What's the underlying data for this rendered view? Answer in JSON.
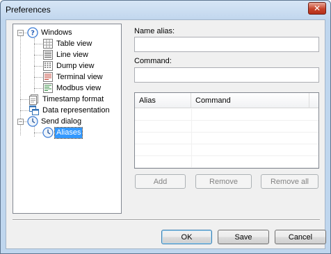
{
  "window": {
    "title": "Preferences",
    "close_glyph": "✕"
  },
  "tree": {
    "items": [
      {
        "label": "Windows",
        "icon": "help-icon",
        "level": 0,
        "expander": "−"
      },
      {
        "label": "Table view",
        "icon": "table-icon",
        "level": 1
      },
      {
        "label": "Line view",
        "icon": "lines-icon",
        "level": 1
      },
      {
        "label": "Dump view",
        "icon": "dump-icon",
        "level": 1
      },
      {
        "label": "Terminal view",
        "icon": "terminal-icon",
        "level": 1
      },
      {
        "label": "Modbus view",
        "icon": "modbus-icon",
        "level": 1
      },
      {
        "label": "Timestamp format",
        "icon": "document-icon",
        "level": 0
      },
      {
        "label": "Data representation",
        "icon": "windows-icon",
        "level": 0
      },
      {
        "label": "Send dialog",
        "icon": "clock-icon",
        "level": 0,
        "expander": "−"
      },
      {
        "label": "Aliases",
        "icon": "clock-icon",
        "level": 1,
        "selected": true
      }
    ]
  },
  "form": {
    "name_alias_label": "Name alias:",
    "name_alias_value": "",
    "command_label": "Command:",
    "command_value": ""
  },
  "list": {
    "columns": [
      "Alias",
      "Command"
    ],
    "rows": []
  },
  "list_buttons": {
    "add": "Add",
    "remove": "Remove",
    "remove_all": "Remove all"
  },
  "footer_buttons": {
    "ok": "OK",
    "save": "Save",
    "cancel": "Cancel"
  },
  "colors": {
    "selection": "#3399ff",
    "title_bar": "#c2d7ee",
    "dialog_bg": "#f0f0f0"
  }
}
